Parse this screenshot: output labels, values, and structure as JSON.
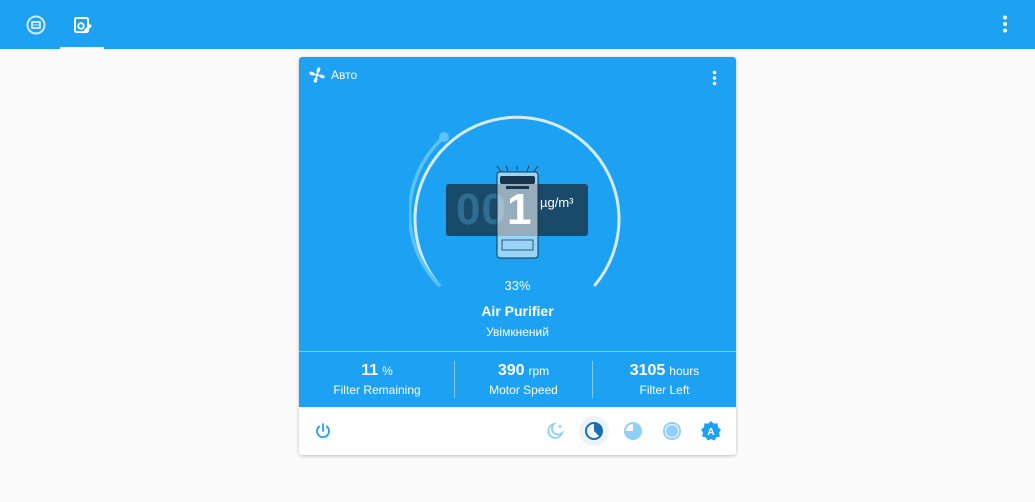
{
  "topbar": {
    "tabs": [
      {
        "icon": "air-purifier-icon",
        "active": false
      },
      {
        "icon": "edit-device-icon",
        "active": true
      }
    ],
    "menu_icon": "more-vert-icon"
  },
  "card": {
    "mode_icon": "fan-icon",
    "mode_label": "Авто",
    "menu_icon": "more-vert-icon",
    "display": {
      "dim_digits": "00",
      "value": "1",
      "unit": "µg/m³"
    },
    "gauge_level": 0.33,
    "percent": "33%",
    "name": "Air Purifier",
    "state": "Увімкнений",
    "stats": [
      {
        "value": "11",
        "unit": "%",
        "label": "Filter Remaining"
      },
      {
        "value": "390",
        "unit": "rpm",
        "label": "Motor Speed"
      },
      {
        "value": "3105",
        "unit": "hours",
        "label": "Filter Left"
      }
    ],
    "controls": {
      "power": "power-icon",
      "modes": [
        "night-mode-icon",
        "low-speed-icon",
        "medium-speed-icon",
        "high-speed-icon",
        "auto-mode-icon"
      ],
      "active_mode": "low-speed-icon"
    }
  },
  "colors": {
    "accent": "#1da1f2",
    "display_bg": "#1a4a6a",
    "background": "#fafafa"
  }
}
